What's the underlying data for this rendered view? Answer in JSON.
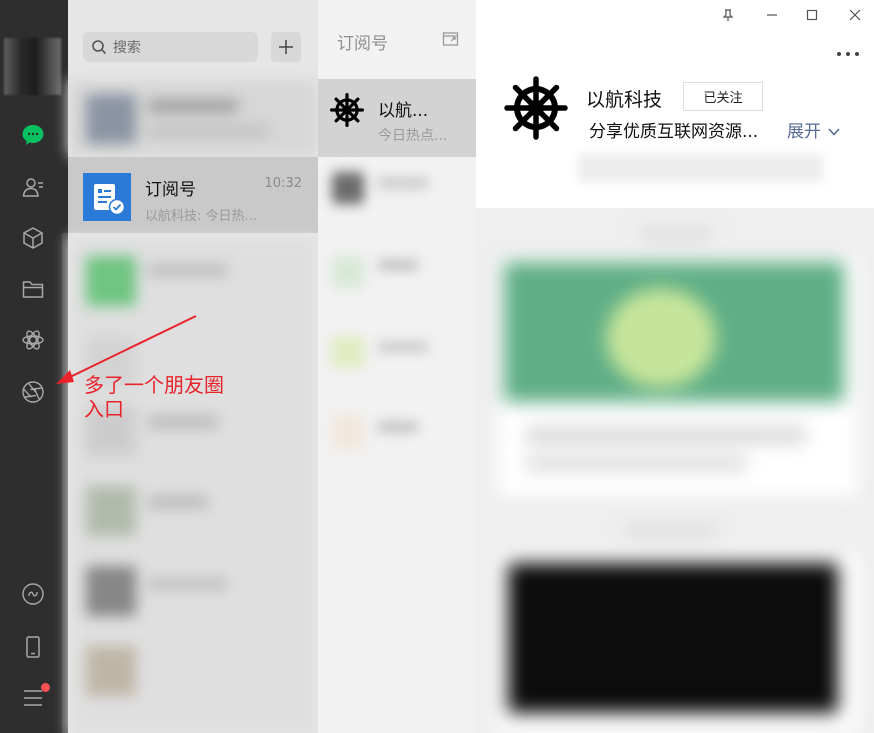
{
  "search": {
    "placeholder": "搜索"
  },
  "chat_list": {
    "active": {
      "name": "订阅号",
      "time": "10:32",
      "preview": "以航科技: 今日热..."
    }
  },
  "subscriptions": {
    "header": "订阅号",
    "items": [
      {
        "name": "以航...",
        "preview": "今日热点..."
      }
    ]
  },
  "account": {
    "name": "以航科技",
    "follow_label": "已关注",
    "description": "分享优质互联网资源...",
    "expand_label": "展开"
  },
  "annotation": {
    "text": "多了一个朋友圈\n入口"
  },
  "colors": {
    "sidebar": "#2e2e2e",
    "accent_green": "#07c160",
    "link": "#576b95",
    "annotation": "#e8232b",
    "badge": "#fa5151"
  },
  "icons": {
    "sidebar": [
      "chat-icon",
      "contacts-icon",
      "favorites-icon",
      "files-icon",
      "moments-icon",
      "channels-icon",
      "mini-programs-icon",
      "phone-icon",
      "menu-icon"
    ],
    "window": [
      "pin-icon",
      "minimize-icon",
      "maximize-icon",
      "close-icon"
    ]
  }
}
